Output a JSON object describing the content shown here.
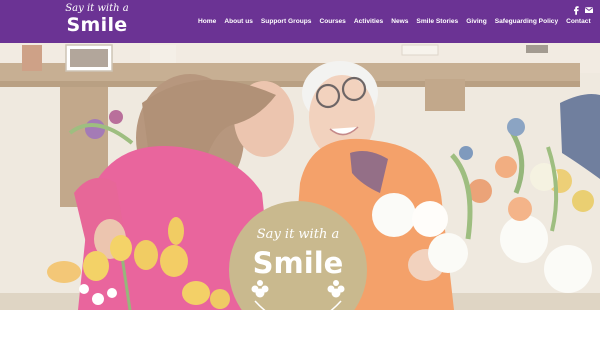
{
  "brand": {
    "logo_small": "Say it with a",
    "logo_big": "Smile"
  },
  "nav": {
    "items": [
      "Home",
      "About us",
      "Support Groups",
      "Courses",
      "Activities",
      "News",
      "Smile Stories",
      "Giving",
      "Safeguarding Policy",
      "Contact"
    ]
  },
  "social": {
    "icons": [
      "facebook-icon",
      "email-icon"
    ]
  },
  "hero": {
    "badge_small": "Say it with a",
    "badge_big": "Smile",
    "image": "two smiling women with bouquets of flowers"
  },
  "colors": {
    "brand_purple": "#6b3394",
    "badge_gold": "#c9b98e"
  }
}
